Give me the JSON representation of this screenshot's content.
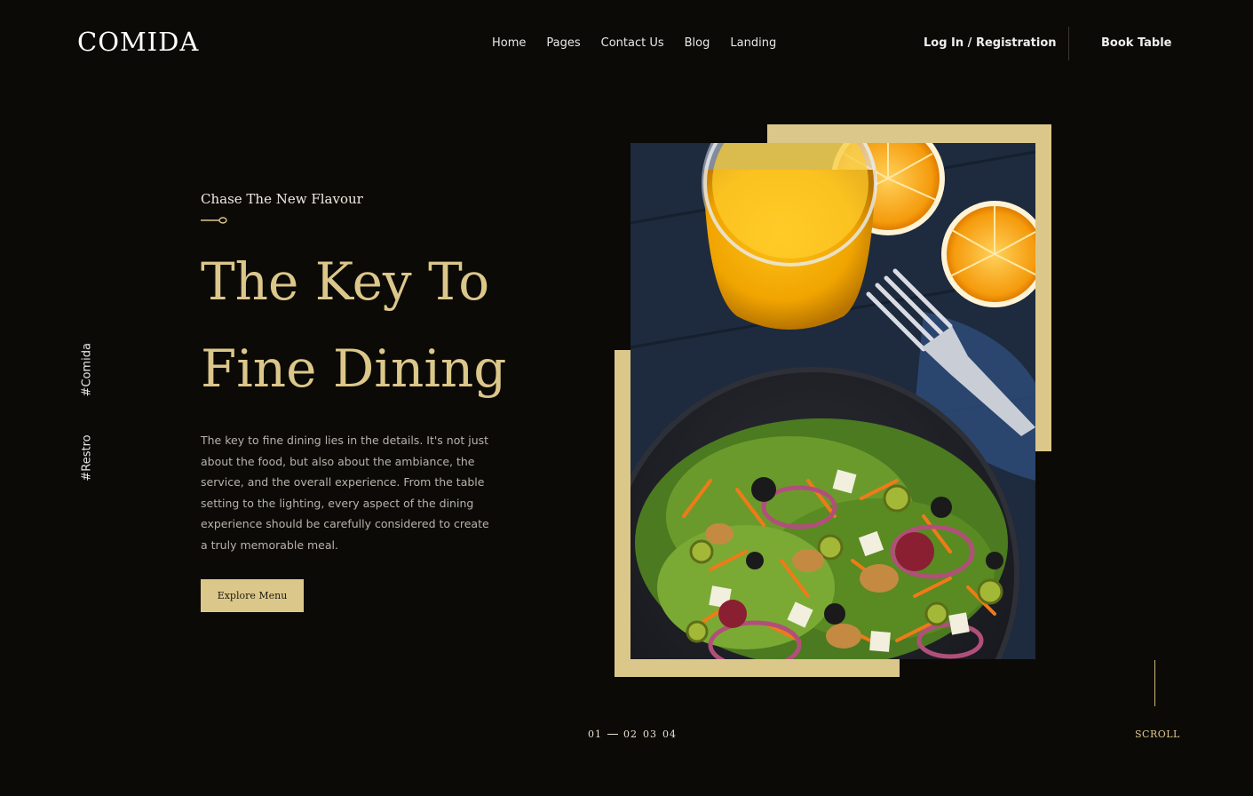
{
  "header": {
    "logo": "COMIDA",
    "nav": [
      "Home",
      "Pages",
      "Contact Us",
      "Blog",
      "Landing"
    ],
    "login": "Log In / Registration",
    "book": "Book Table"
  },
  "side_tags": [
    "#Comida",
    "#Restro"
  ],
  "hero": {
    "subtitle": "Chase The New Flavour",
    "headline_line1": "The Key To",
    "headline_line2": "Fine Dining",
    "description": "The key to fine dining lies in the details. It's not just about the food, but also about the ambiance, the service, and the overall experience. From the table setting to the lighting, every aspect of the dining experience should be carefully considered to create a truly memorable meal.",
    "cta": "Explore Menu"
  },
  "pager": {
    "current": "01",
    "others": [
      "02",
      "03",
      "04"
    ]
  },
  "scroll_label": "SCROLL",
  "colors": {
    "background": "#0c0a07",
    "accent": "#dcc78a"
  }
}
